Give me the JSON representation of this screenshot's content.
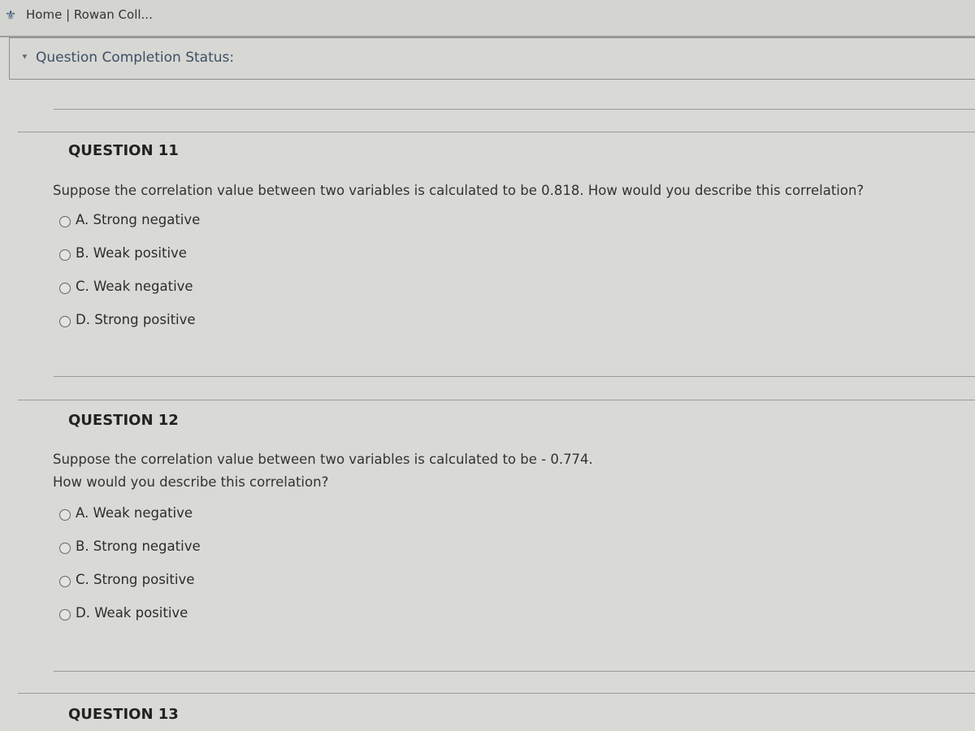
{
  "header": {
    "logo_icon": "rowan-logo-icon",
    "breadcrumb": "Home | Rowan Coll..."
  },
  "status_panel": {
    "toggle_icon": "double-chevron-down-icon",
    "label": "Question Completion Status:"
  },
  "questions": [
    {
      "title": "QUESTION 11",
      "text_lines": [
        "Suppose the correlation value between two variables is calculated to be 0.818.  How would you describe this correlation?"
      ],
      "options": [
        {
          "label": "A. Strong negative",
          "selected": false
        },
        {
          "label": "B. Weak positive",
          "selected": false
        },
        {
          "label": "C. Weak negative",
          "selected": false
        },
        {
          "label": "D. Strong positive",
          "selected": false
        }
      ]
    },
    {
      "title": "QUESTION 12",
      "text_lines": [
        "Suppose the correlation value between two variables is calculated to be - 0.774.",
        "How would you describe this correlation?"
      ],
      "options": [
        {
          "label": "A. Weak negative",
          "selected": false
        },
        {
          "label": "B. Strong negative",
          "selected": false
        },
        {
          "label": "C. Strong positive",
          "selected": false
        },
        {
          "label": "D. Weak positive",
          "selected": false
        }
      ]
    },
    {
      "title": "QUESTION 13"
    }
  ]
}
